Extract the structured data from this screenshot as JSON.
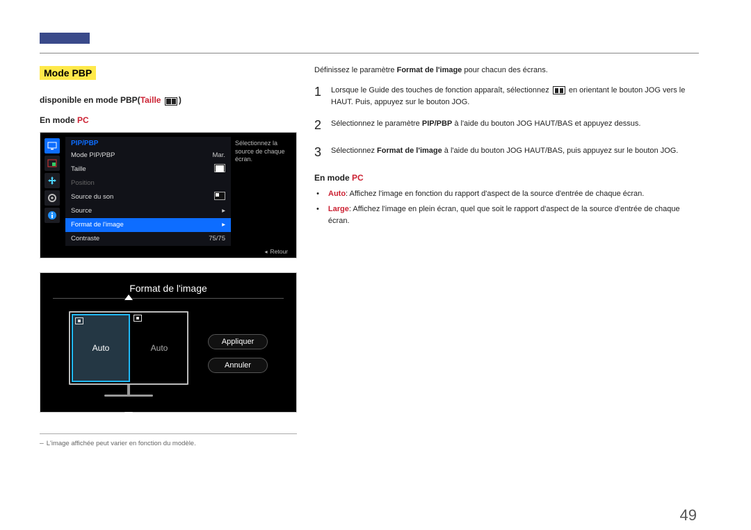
{
  "page_number": "49",
  "left": {
    "title": "Mode PBP",
    "subtitle_prefix": "disponible en mode PBP(",
    "subtitle_red": "Taille",
    "subtitle_suffix": ")",
    "mode_prefix": "En mode ",
    "mode_red": "PC",
    "osd1": {
      "title": "PIP/PBP",
      "rows": {
        "r1_label": "Mode PIP/PBP",
        "r1_value": "Mar.",
        "r2_label": "Taille",
        "r3_label": "Position",
        "r4_label": "Source du son",
        "r5_label": "Source",
        "r5_arrow": "▸",
        "r6_label": "Format de l'image",
        "r6_arrow": "▸",
        "r7_label": "Contraste",
        "r7_value": "75/75"
      },
      "help": "Sélectionnez la source de chaque écran.",
      "back_label": "Retour"
    },
    "osd2": {
      "title": "Format de l'image",
      "left_label": "Auto",
      "right_label": "Auto",
      "btn_apply": "Appliquer",
      "btn_cancel": "Annuler"
    },
    "footnote": "L'image affichée peut varier en fonction du modèle."
  },
  "right": {
    "intro_a": "Définissez le paramètre ",
    "intro_b": "Format de l'image",
    "intro_c": " pour chacun des écrans.",
    "step1a": "Lorsque le Guide des touches de fonction apparaît, sélectionnez ",
    "step1b": " en orientant le bouton JOG vers le HAUT. Puis, appuyez sur le bouton JOG.",
    "step2a": "Sélectionnez le paramètre ",
    "step2b": "PIP/PBP",
    "step2c": " à l'aide du bouton JOG HAUT/BAS et appuyez dessus.",
    "step3a": "Sélectionnez ",
    "step3b": "Format de l'image",
    "step3c": " à l'aide du bouton JOG HAUT/BAS, puis appuyez sur le bouton JOG.",
    "mode_prefix": "En mode ",
    "mode_red": "PC",
    "bullet1_b": "Auto",
    "bullet1_t": ": Affichez l'image en fonction du rapport d'aspect de la source d'entrée de chaque écran.",
    "bullet2_b": "Large",
    "bullet2_t": ": Affichez l'image en plein écran, quel que soit le rapport d'aspect de la source d'entrée de chaque écran.",
    "n1": "1",
    "n2": "2",
    "n3": "3"
  }
}
